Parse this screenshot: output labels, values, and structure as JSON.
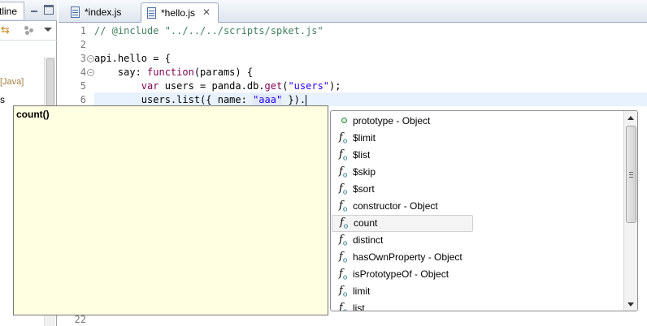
{
  "outline": {
    "tab_label": "tline",
    "java_label": "[Java]",
    "item_label": "s"
  },
  "editor": {
    "tabs": [
      {
        "label": "*index.js"
      },
      {
        "label": "*hello.js",
        "active": true
      }
    ],
    "line_numbers": [
      "1",
      "2",
      "3",
      "4",
      "5",
      "6",
      "22"
    ],
    "code": {
      "line1": "// @include \"../../../scripts/spket.js\"",
      "line3": "api.hello = {",
      "line4_indent": "    say: ",
      "line4_kw": "function",
      "line4_rest": "(params) {",
      "line5_indent": "        ",
      "line5_kw": "var",
      "line5_mid": " users = panda.db.",
      "line5_get": "get",
      "line5_open": "(",
      "line5_str": "\"users\"",
      "line5_close": ");",
      "line6_start": "        users.list({ name: ",
      "line6_str": "\"aaa\"",
      "line6_end": " }).",
      "line6_err": "."
    }
  },
  "info_popup": {
    "title": "count()"
  },
  "proposals": {
    "items": [
      {
        "icon": "property-icon",
        "label": "prototype - Object"
      },
      {
        "icon": "function-icon",
        "label": "$limit"
      },
      {
        "icon": "function-icon",
        "label": "$list"
      },
      {
        "icon": "function-icon",
        "label": "$skip"
      },
      {
        "icon": "function-icon",
        "label": "$sort"
      },
      {
        "icon": "function-icon",
        "label": "constructor - Object"
      },
      {
        "icon": "function-icon",
        "label": "count",
        "selected": true
      },
      {
        "icon": "function-icon",
        "label": "distinct"
      },
      {
        "icon": "function-icon",
        "label": "hasOwnProperty - Object"
      },
      {
        "icon": "function-icon",
        "label": "isPrototypeOf - Object"
      },
      {
        "icon": "function-icon",
        "label": "limit"
      },
      {
        "icon": "function-icon",
        "label": "list"
      }
    ]
  },
  "colors": {
    "comment": "#3f7f5f",
    "keyword": "#7f0055",
    "string": "#2a00ff",
    "info_background": "#ffffe1",
    "current_line": "#e8f2fe"
  }
}
